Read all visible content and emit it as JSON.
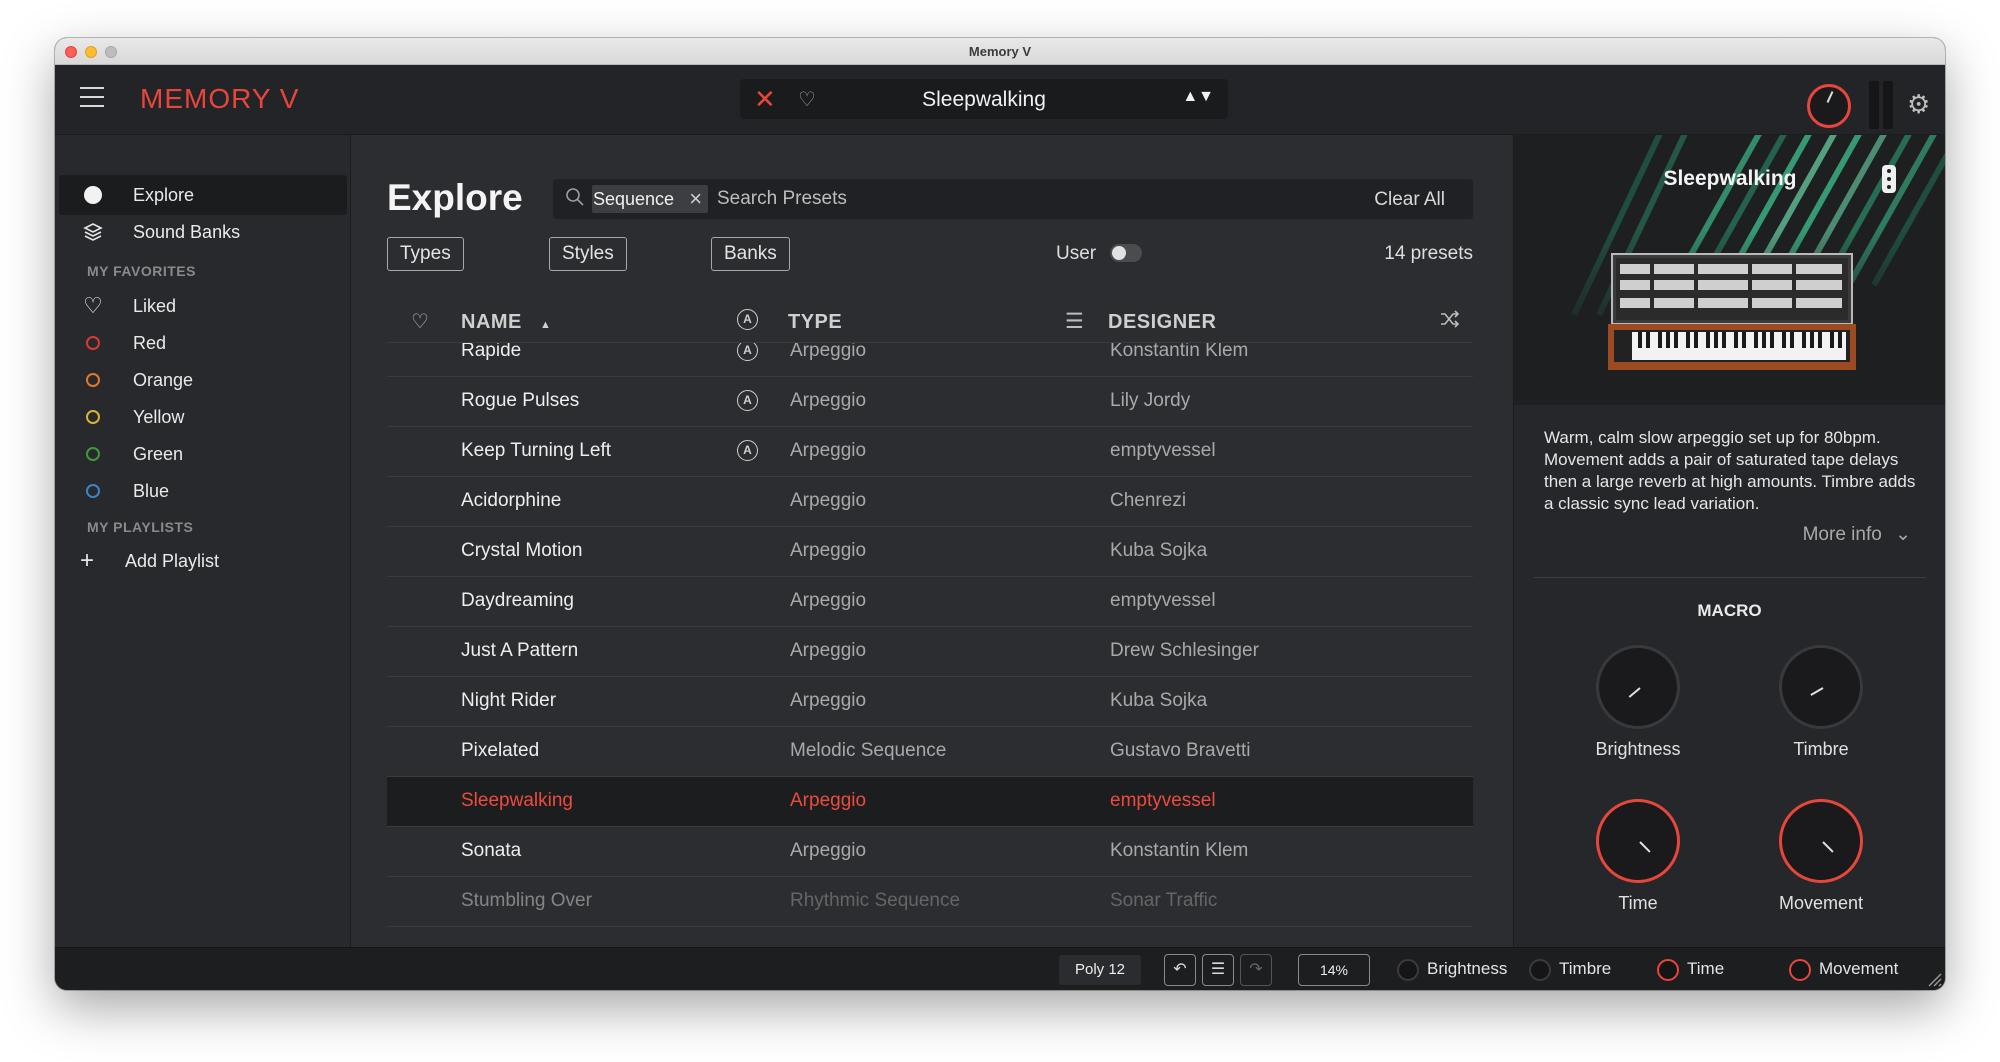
{
  "window": {
    "title": "Memory V"
  },
  "app": {
    "name": "MEMORY V",
    "accent": "#e8463b"
  },
  "topbar": {
    "preset_name": "Sleepwalking",
    "close_icon": "x-icon",
    "heart_icon": "heart-icon",
    "arrows": "▲▼"
  },
  "sidebar": {
    "nav": [
      {
        "label": "Explore",
        "icon": "search-icon",
        "active": true
      },
      {
        "label": "Sound Banks",
        "icon": "layers-icon",
        "active": false
      }
    ],
    "favorites_header": "MY FAVORITES",
    "favorites": [
      {
        "label": "Liked",
        "icon": "heart-icon"
      },
      {
        "label": "Red",
        "color": "#d83b35"
      },
      {
        "label": "Orange",
        "color": "#e07a2a"
      },
      {
        "label": "Yellow",
        "color": "#d8b531"
      },
      {
        "label": "Green",
        "color": "#3c9a3c"
      },
      {
        "label": "Blue",
        "color": "#3a84c9"
      }
    ],
    "playlists_header": "MY PLAYLISTS",
    "add_playlist": "Add Playlist"
  },
  "explore": {
    "title": "Explore",
    "search": {
      "tag": "Sequence",
      "placeholder": "Search Presets",
      "clear": "Clear All"
    },
    "filters": {
      "types": "Types",
      "styles": "Styles",
      "banks": "Banks",
      "user": "User"
    },
    "count": "14 presets",
    "columns": {
      "name": "NAME",
      "name_sort": "▲",
      "type": "TYPE",
      "designer": "DESIGNER"
    },
    "rows": [
      {
        "name": "Rapide",
        "type": "Arpeggio",
        "designer": "Konstantin Klem",
        "arturia": true
      },
      {
        "name": "Rogue Pulses",
        "type": "Arpeggio",
        "designer": "Lily Jordy",
        "arturia": true
      },
      {
        "name": "Keep Turning Left",
        "type": "Arpeggio",
        "designer": "emptyvessel",
        "arturia": true
      },
      {
        "name": "Acidorphine",
        "type": "Arpeggio",
        "designer": "Chenrezi"
      },
      {
        "name": "Crystal Motion",
        "type": "Arpeggio",
        "designer": "Kuba Sojka"
      },
      {
        "name": "Daydreaming",
        "type": "Arpeggio",
        "designer": "emptyvessel"
      },
      {
        "name": "Just A Pattern",
        "type": "Arpeggio",
        "designer": "Drew Schlesinger"
      },
      {
        "name": "Night Rider",
        "type": "Arpeggio",
        "designer": "Kuba Sojka"
      },
      {
        "name": "Pixelated",
        "type": "Melodic Sequence",
        "designer": "Gustavo Bravetti"
      },
      {
        "name": "Sleepwalking",
        "type": "Arpeggio",
        "designer": "emptyvessel",
        "selected": true
      },
      {
        "name": "Sonata",
        "type": "Arpeggio",
        "designer": "Konstantin Klem"
      },
      {
        "name": "Stumbling Over",
        "type": "Rhythmic Sequence",
        "designer": "Sonar Traffic",
        "faded": true
      }
    ]
  },
  "panel": {
    "preset_name": "Sleepwalking",
    "description": "Warm, calm slow arpeggio set up for 80bpm. Movement adds a pair of saturated tape delays then a large reverb at high amounts. Timbre adds a classic sync lead variation.",
    "more_info": "More info",
    "macro_title": "MACRO",
    "macros": [
      {
        "label": "Brightness",
        "value": 0.15,
        "active": false
      },
      {
        "label": "Timbre",
        "value": 0.22,
        "active": false
      },
      {
        "label": "Time",
        "value": 0.85,
        "active": true
      },
      {
        "label": "Movement",
        "value": 0.85,
        "active": true
      }
    ]
  },
  "bottombar": {
    "poly": "Poly 12",
    "zoom": "14%",
    "macros": [
      "Brightness",
      "Timbre",
      "Time",
      "Movement"
    ]
  }
}
